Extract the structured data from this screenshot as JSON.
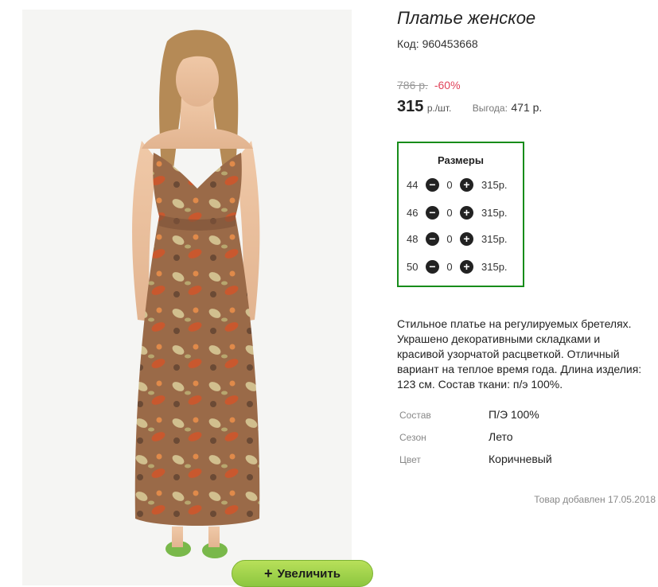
{
  "product": {
    "title": "Платье женское",
    "code_label": "Код:",
    "code": "960453668"
  },
  "pricing": {
    "old_price": "786 р.",
    "discount": "-60%",
    "price": "315",
    "price_unit": "р./шт.",
    "savings_label": "Выгода:",
    "savings_value": "471 р."
  },
  "sizes": {
    "title": "Размеры",
    "rows": [
      {
        "size": "44",
        "qty": "0",
        "price": "315р."
      },
      {
        "size": "46",
        "qty": "0",
        "price": "315р."
      },
      {
        "size": "48",
        "qty": "0",
        "price": "315р."
      },
      {
        "size": "50",
        "qty": "0",
        "price": "315р."
      }
    ]
  },
  "description": "Стильное платье на регулируемых бретелях. Украшено декоративными складками и красивой узорчатой расцветкой. Отличный вариант на теплое время года. Длина изделия: 123 см. Состав ткани: п/э 100%.",
  "properties": [
    {
      "key": "Состав",
      "value": "П/Э 100%"
    },
    {
      "key": "Сезон",
      "value": "Лето"
    },
    {
      "key": "Цвет",
      "value": "Коричневый"
    }
  ],
  "added_date": "Товар добавлен 17.05.2018",
  "zoom_button": {
    "icon": "+",
    "label": "Увеличить"
  },
  "colors": {
    "accent_green": "#178c1a",
    "discount_red": "#e0435a",
    "button_green": "#8cc63f"
  }
}
